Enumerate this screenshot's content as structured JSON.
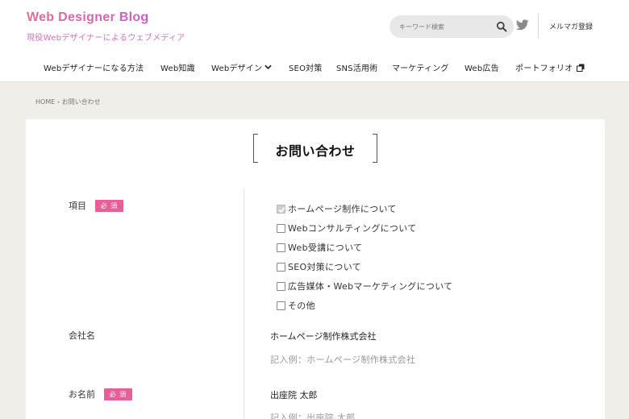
{
  "site": {
    "title": "Web Designer Blog",
    "tagline": "現役Webデザイナーによるウェブメディア"
  },
  "search": {
    "placeholder": "キーワード検索"
  },
  "header": {
    "newsletter_label": "メルマガ登録"
  },
  "nav": {
    "items": [
      {
        "label": "Webデザイナーになる方法"
      },
      {
        "label": "Web知識"
      },
      {
        "label": "Webデザイン"
      },
      {
        "label": "SEO対策"
      },
      {
        "label": "SNS活用術"
      },
      {
        "label": "マーケティング"
      },
      {
        "label": "Web広告"
      },
      {
        "label": "ポートフォリオ"
      }
    ]
  },
  "breadcrumb": {
    "home": "HOME",
    "separator": "›",
    "current": "お問い合わせ"
  },
  "page": {
    "title": "お問い合わせ"
  },
  "form": {
    "required_label": "必 須",
    "item_field": {
      "label": "項目",
      "options": [
        {
          "label": "ホームページ制作について",
          "checked": true
        },
        {
          "label": "Webコンサルティングについて",
          "checked": false
        },
        {
          "label": "Web受講について",
          "checked": false
        },
        {
          "label": "SEO対策について",
          "checked": false
        },
        {
          "label": "広告媒体・Webマーケティングについて",
          "checked": false
        },
        {
          "label": "その他",
          "checked": false
        }
      ]
    },
    "company_field": {
      "label": "会社名",
      "value": "ホームページ制作株式会社",
      "example": "記入例：ホームページ制作株式会社"
    },
    "name_field": {
      "label": "お名前",
      "value": "出座院 太郎",
      "example": "記入例：出座院 太郎"
    }
  },
  "colors": {
    "brand_pink": "#e36b97",
    "brand_purple": "#c85fc9",
    "required_badge": "#e85e99",
    "page_background": "#efeee9"
  }
}
